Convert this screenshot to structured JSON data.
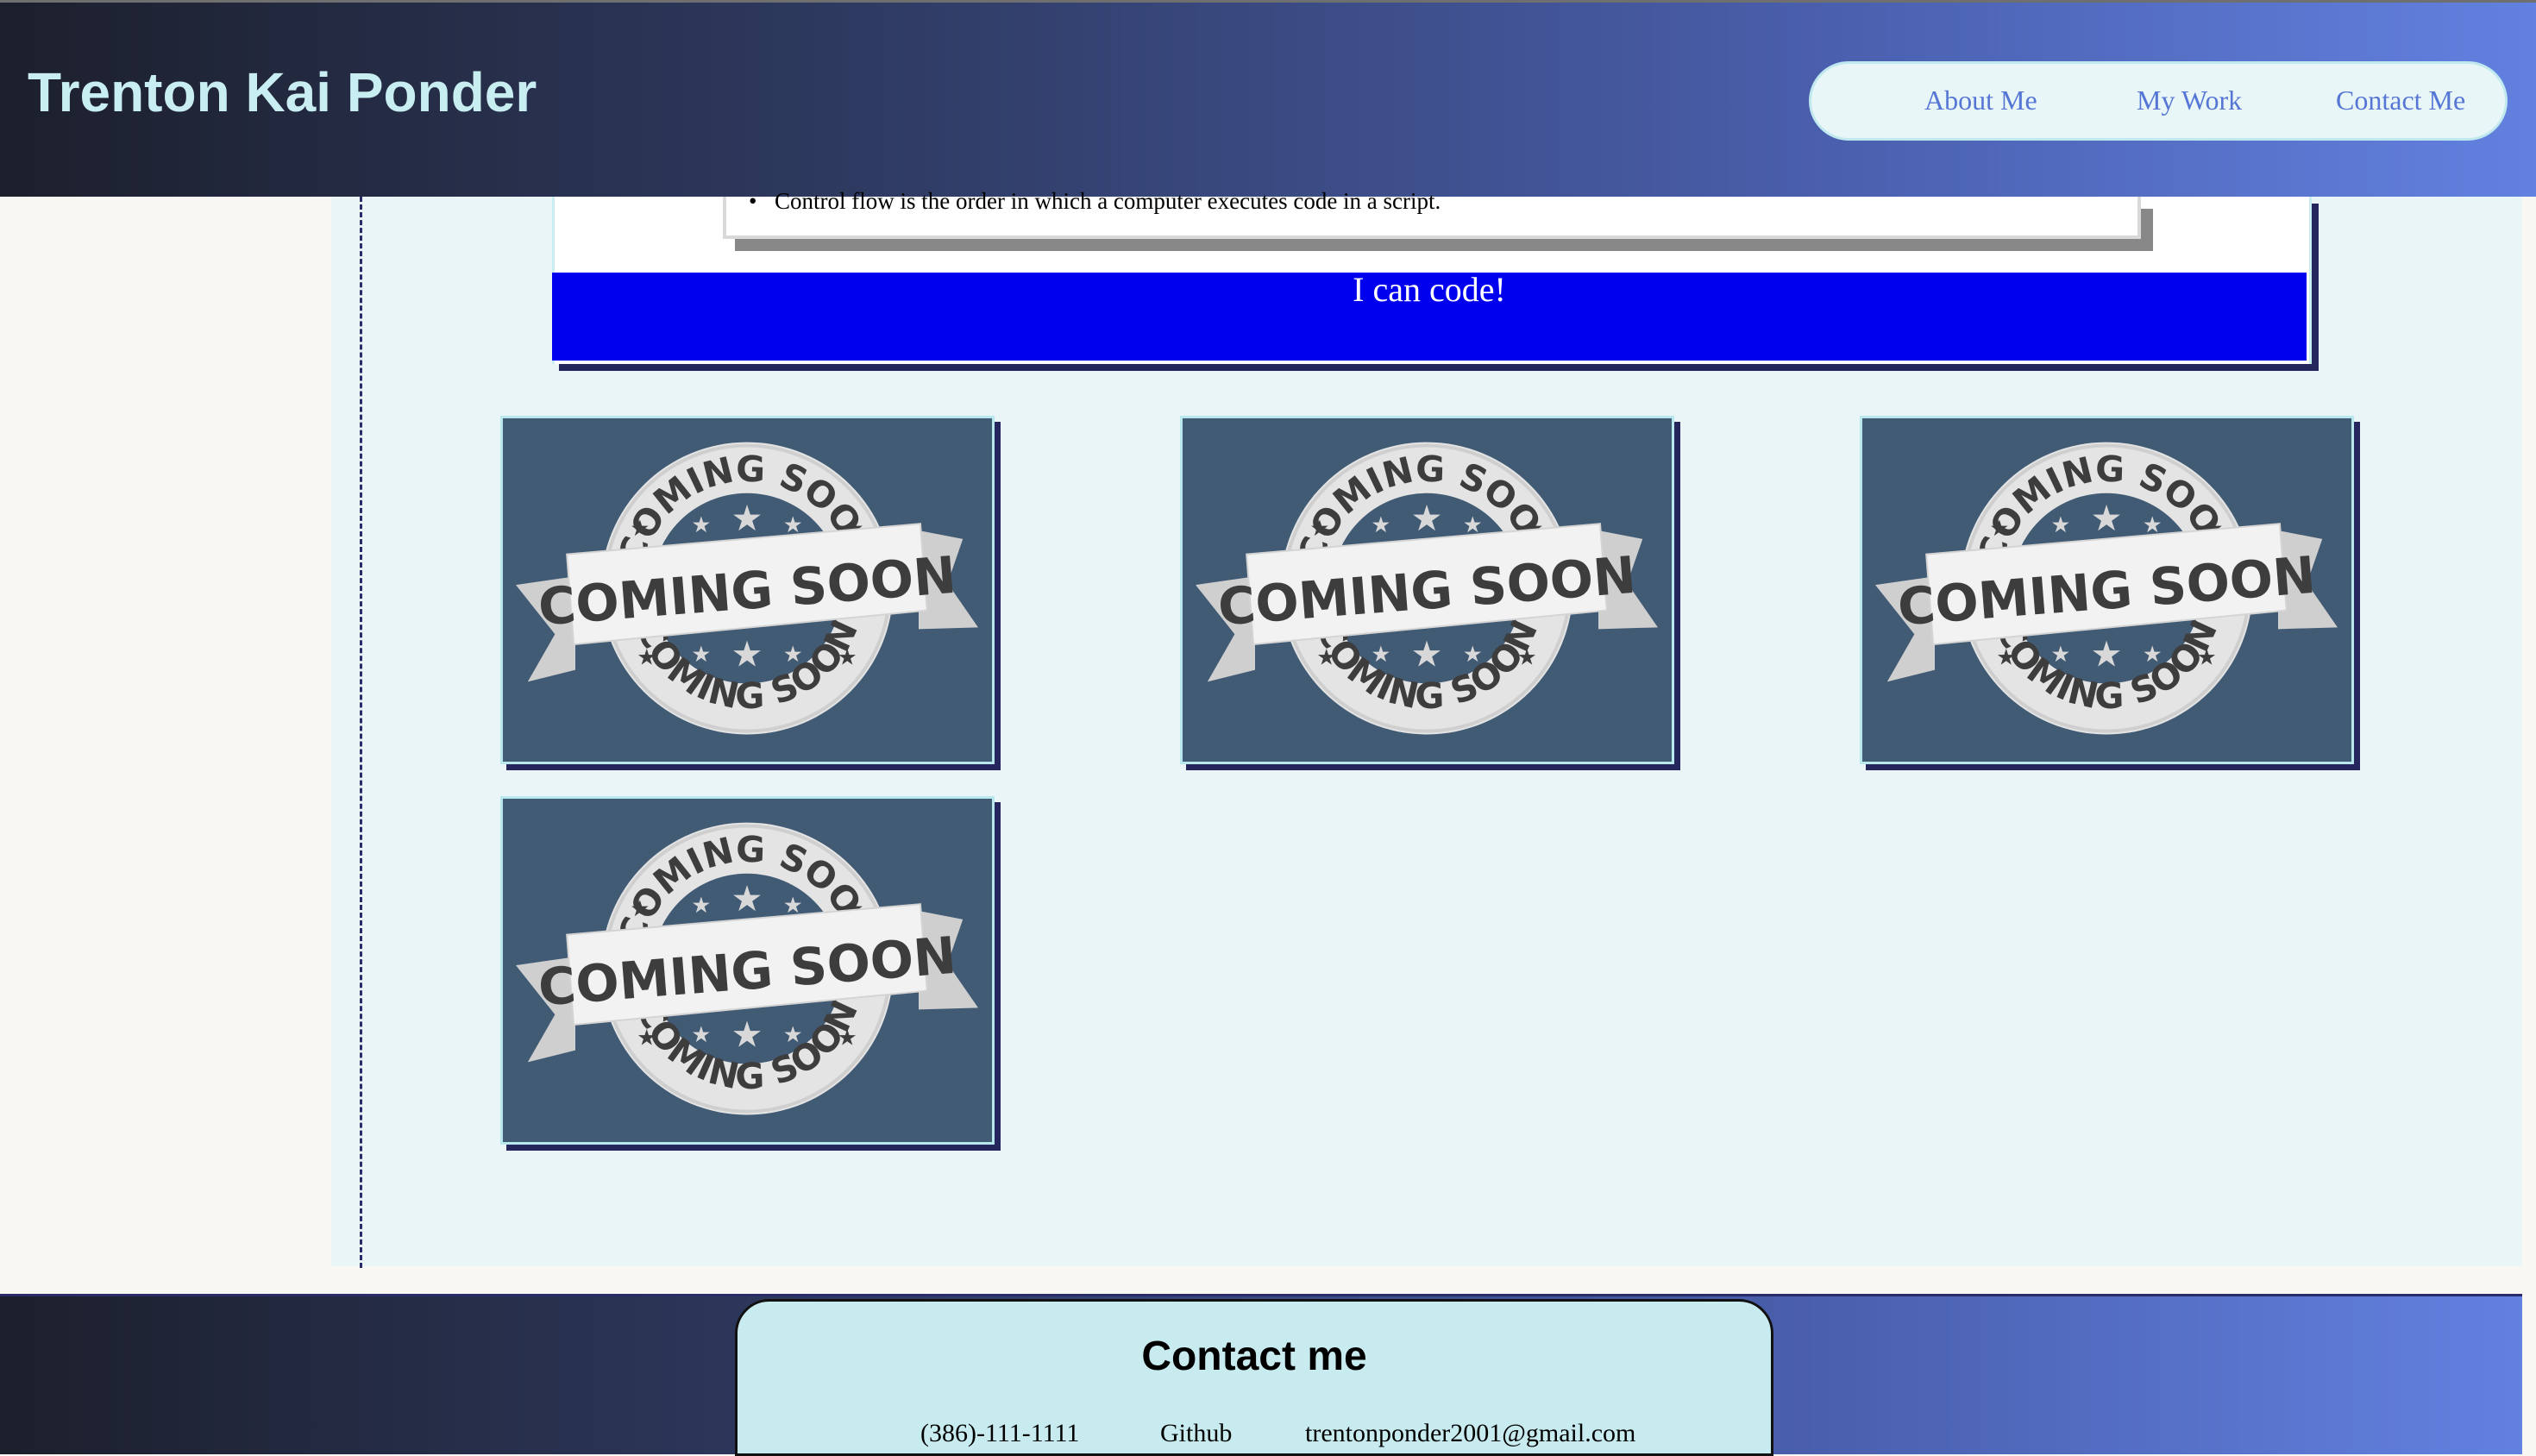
{
  "header": {
    "title": "Trenton Kai Ponder",
    "nav": [
      {
        "label": "About Me"
      },
      {
        "label": "My Work"
      },
      {
        "label": "Contact Me"
      }
    ]
  },
  "work": {
    "concept_bullet": "Control flow is the order in which a computer executes code in a script.",
    "banner_text": "I can code!",
    "cards": [
      {
        "image": "coming-soon-badge",
        "badge_text": "COMING SOON"
      },
      {
        "image": "coming-soon-badge",
        "badge_text": "COMING SOON"
      },
      {
        "image": "coming-soon-badge",
        "badge_text": "COMING SOON"
      },
      {
        "image": "coming-soon-badge",
        "badge_text": "COMING SOON"
      }
    ]
  },
  "footer": {
    "title": "Contact me",
    "phone": "(386)-111-1111",
    "github": "Github",
    "email": "trentonponder2001@gmail.com"
  },
  "colors": {
    "header_gradient_start": "#1c1f2c",
    "header_gradient_end": "#6281e0",
    "title_color": "#c8eef2",
    "nav_link": "#5576d4",
    "banner_blue": "#0000ee",
    "card_bg": "#425b75",
    "contact_bg": "#c8ebf0"
  }
}
